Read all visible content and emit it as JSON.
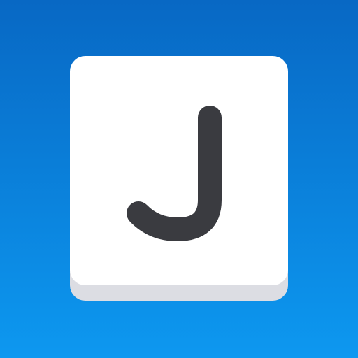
{
  "icon": {
    "letter": "J",
    "background_top_color": "#0868c4",
    "background_bottom_color": "#0d98f0",
    "key_face_color": "#ffffff",
    "key_edge_color": "#dcdde3",
    "letter_color": "#3a3b40"
  }
}
